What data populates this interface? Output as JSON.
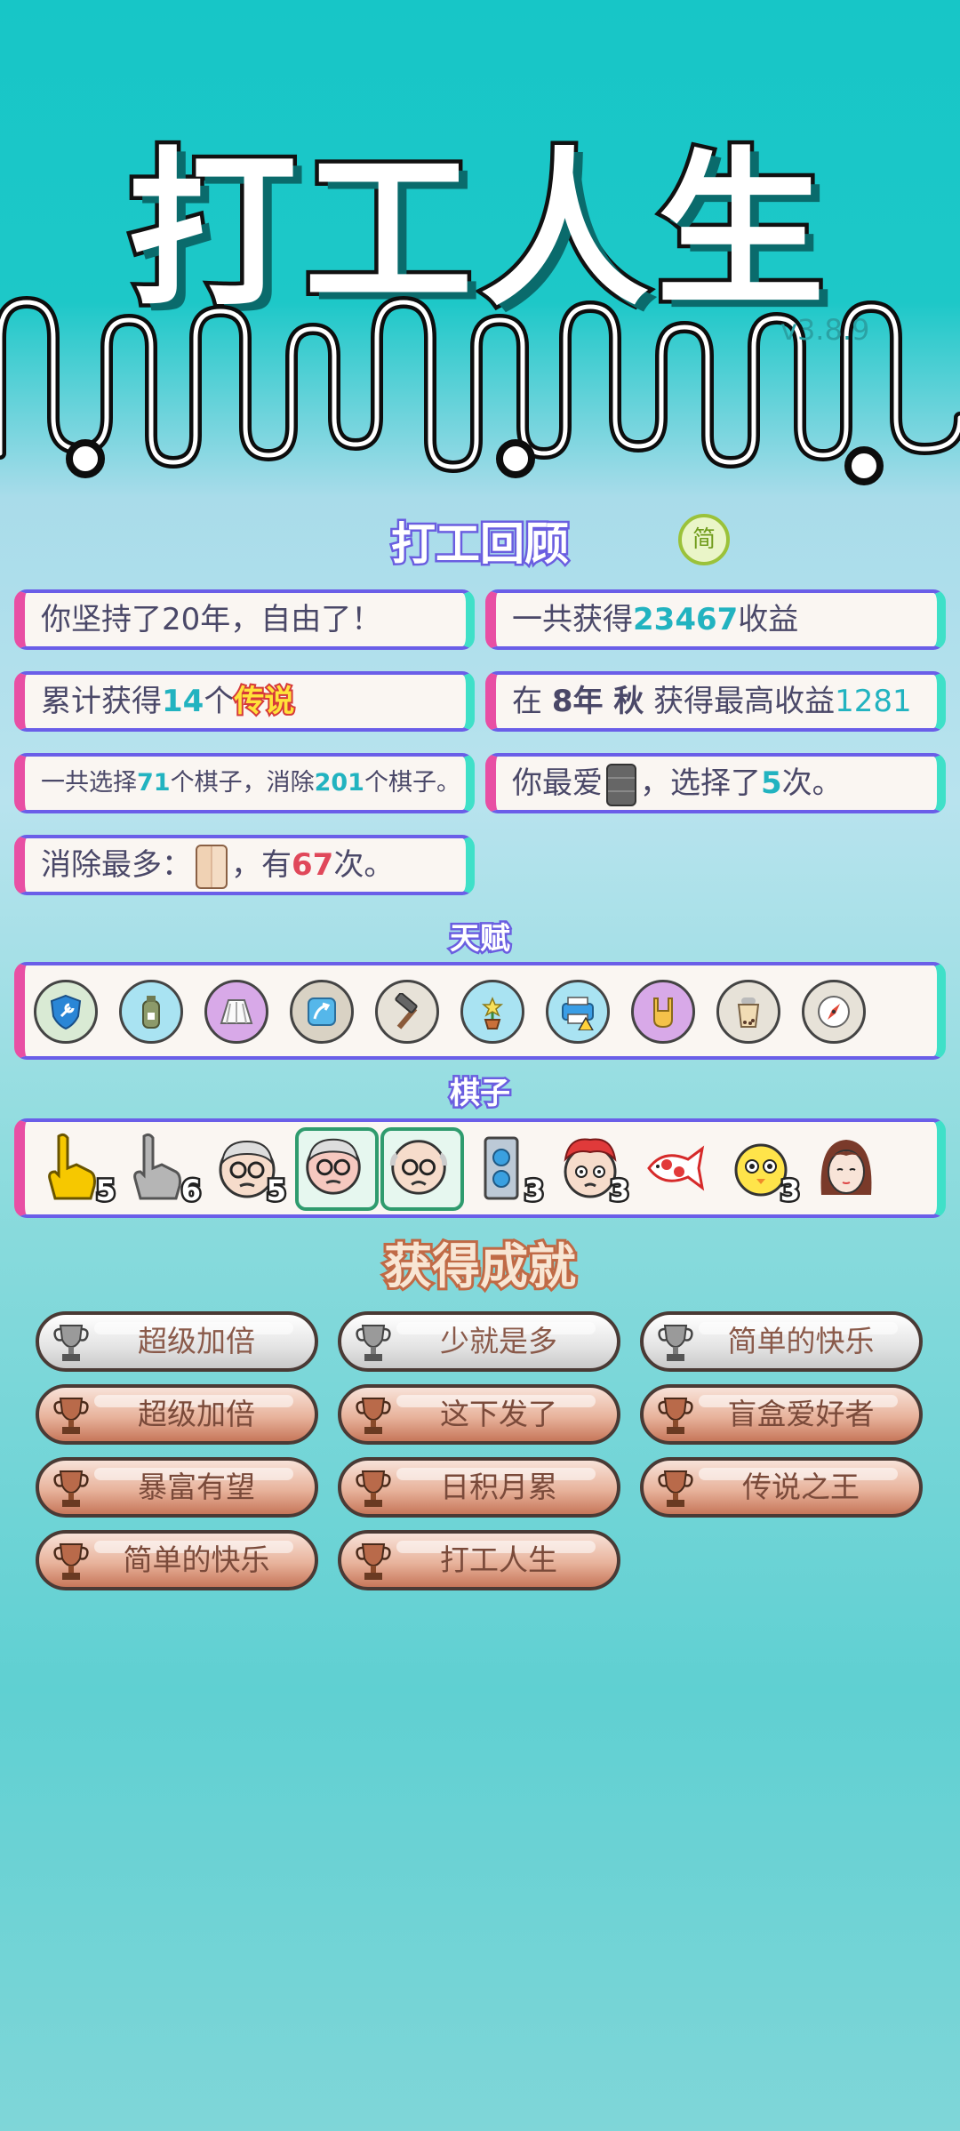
{
  "header": {
    "title": "打工人生",
    "version": "v3.8.9"
  },
  "review": {
    "title": "打工回顾",
    "toggle_label": "简",
    "cards": [
      {
        "parts": [
          "你坚持了20年，自由了！"
        ]
      },
      {
        "prefix": "一共获得",
        "value": "23467",
        "suffix": "收益"
      },
      {
        "prefix": "累计获得",
        "value": "14",
        "mid": "个",
        "legend": "传说"
      },
      {
        "prefix": "在 ",
        "year": "8年 秋",
        "mid": " 获得最高收益",
        "value": "1281"
      },
      {
        "prefix": "一共选择",
        "v1": "71",
        "mid": "个棋子，消除",
        "v2": "201",
        "suffix": "个棋子。"
      },
      {
        "prefix": "你最爱",
        "icon": "server-rack-icon",
        "mid": "，选择了",
        "value": "5",
        "suffix": "次。"
      },
      {
        "prefix": "消除最多：",
        "icon": "door-icon",
        "mid": "，有",
        "value": "67",
        "suffix": "次。"
      }
    ]
  },
  "talents": {
    "title": "天赋",
    "items": [
      "shield-wrench-icon",
      "gas-bottle-icon",
      "skirt-icon",
      "arrow-card-icon",
      "hammer-icon",
      "flower-pot-icon",
      "printer-icon",
      "rock-hand-icon",
      "bubble-tea-icon",
      "compass-icon"
    ]
  },
  "pieces": {
    "title": "棋子",
    "items": [
      {
        "icon": "gold-hand-icon",
        "count": "5"
      },
      {
        "icon": "gray-hand-icon",
        "count": "6"
      },
      {
        "icon": "old-man-icon",
        "count": "5"
      },
      {
        "icon": "old-man-red-icon",
        "count": ""
      },
      {
        "icon": "bald-man-icon",
        "count": ""
      },
      {
        "icon": "server-rack-icon",
        "count": "3"
      },
      {
        "icon": "red-hair-boy-icon",
        "count": "3"
      },
      {
        "icon": "koi-fish-icon",
        "count": ""
      },
      {
        "icon": "chick-face-icon",
        "count": "3"
      },
      {
        "icon": "girl-face-icon",
        "count": ""
      }
    ]
  },
  "achievements": {
    "title": "获得成就",
    "items": [
      {
        "label": "超级加倍",
        "tier": "silver"
      },
      {
        "label": "少就是多",
        "tier": "silver"
      },
      {
        "label": "简单的快乐",
        "tier": "silver"
      },
      {
        "label": "超级加倍",
        "tier": "bronze"
      },
      {
        "label": "这下发了",
        "tier": "bronze"
      },
      {
        "label": "盲盒爱好者",
        "tier": "bronze"
      },
      {
        "label": "暴富有望",
        "tier": "bronze"
      },
      {
        "label": "日积月累",
        "tier": "bronze"
      },
      {
        "label": "传说之王",
        "tier": "bronze"
      },
      {
        "label": "简单的快乐",
        "tier": "bronze"
      },
      {
        "label": "打工人生",
        "tier": "bronze"
      }
    ]
  },
  "colors": {
    "accent": "#22b3c0",
    "border": "#6a5ee8",
    "pink": "#e84fa4",
    "mint": "#3fe0c8",
    "background": "#17c6c7"
  }
}
